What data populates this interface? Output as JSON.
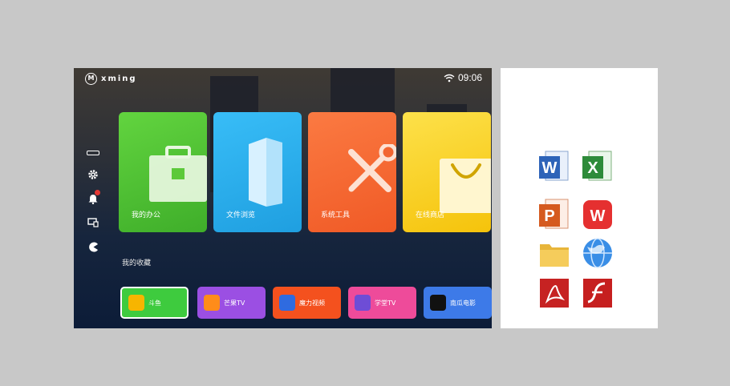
{
  "header": {
    "logo_text": "xming",
    "time": "09:06"
  },
  "sidebar": {
    "items": [
      "menu-bar-icon",
      "settings-gear-icon",
      "notification-bell-icon",
      "screen-cast-icon",
      "pacman-game-icon"
    ]
  },
  "cards": [
    {
      "label": "我的办公",
      "color": "#55c535"
    },
    {
      "label": "文件浏览",
      "color": "#2fb1f0"
    },
    {
      "label": "系统工具",
      "color": "#f86a35"
    },
    {
      "label": "在线商店",
      "color": "#f9cf16"
    }
  ],
  "favorites": {
    "title": "我的收藏",
    "apps": [
      {
        "label": "斗鱼",
        "color": "#3ecb3e"
      },
      {
        "label": "芒果TV",
        "color": "#9b4fe3"
      },
      {
        "label": "魔力视频",
        "color": "#f4511e"
      },
      {
        "label": "学堂TV",
        "color": "#ee4b9a"
      },
      {
        "label": "南瓜电影",
        "color": "#3d7ae8"
      }
    ]
  },
  "office_icons": [
    "word-icon",
    "excel-icon",
    "powerpoint-icon",
    "wps-icon",
    "folder-icon",
    "browser-globe-icon",
    "pdf-icon",
    "flash-icon"
  ]
}
